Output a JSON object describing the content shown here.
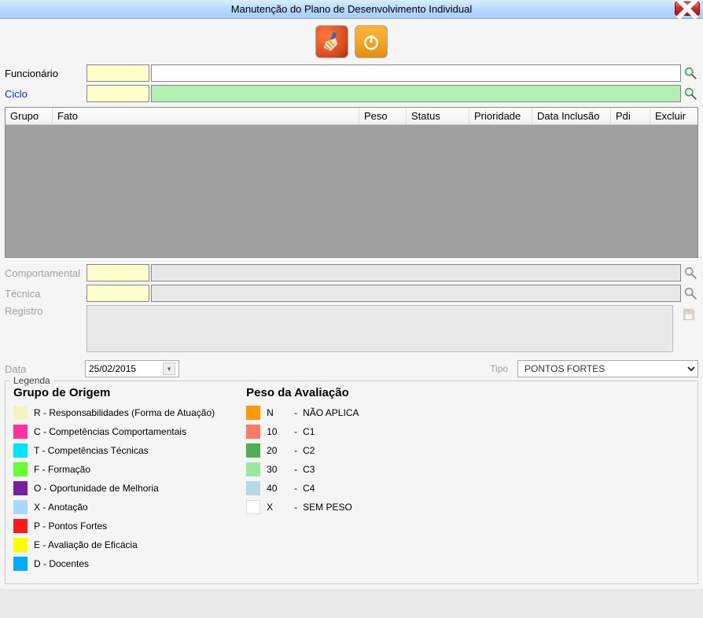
{
  "window": {
    "title": "Manutenção do Plano de Desenvolvimento Individual"
  },
  "form": {
    "funcionario_label": "Funcionário",
    "ciclo_label": "Ciclo",
    "comportamental_label": "Comportamental",
    "tecnica_label": "Técnica",
    "registro_label": "Registro",
    "data_label": "Data",
    "tipo_label": "Tipo",
    "data_value": "25/02/2015",
    "tipo_value": "PONTOS FORTES"
  },
  "grid": {
    "cols": {
      "grupo": "Grupo",
      "fato": "Fato",
      "peso": "Peso",
      "status": "Status",
      "prioridade": "Prioridade",
      "dataInclusao": "Data Inclusão",
      "pdi": "Pdi",
      "excluir": "Excluir"
    }
  },
  "legend": {
    "box_title": "Legenda",
    "origem_title": "Grupo de Origem",
    "origem": [
      {
        "color": "#f7f3c0",
        "text": "R - Responsabilidades (Forma de Atuação)"
      },
      {
        "color": "#ff3399",
        "text": "C - Competências Comportamentais"
      },
      {
        "color": "#00e5ff",
        "text": "T - Competências Técnicas"
      },
      {
        "color": "#66ff33",
        "text": "F - Formação"
      },
      {
        "color": "#7a1fa2",
        "text": "O - Oportunidade de Melhoria"
      },
      {
        "color": "#a8d8ff",
        "text": "X - Anotação"
      },
      {
        "color": "#ff1a1a",
        "text": "P - Pontos Fortes"
      },
      {
        "color": "#ffff00",
        "text": "E - Avaliação de Eficácia"
      },
      {
        "color": "#00aaff",
        "text": "D - Docentes"
      }
    ],
    "peso_title": "Peso da Avaliação",
    "peso": [
      {
        "color": "#ff9900",
        "code": "N",
        "label": "NÃO APLICA"
      },
      {
        "color": "#ff7a66",
        "code": "10",
        "label": "C1"
      },
      {
        "color": "#4caf50",
        "code": "20",
        "label": "C2"
      },
      {
        "color": "#9be6a1",
        "code": "30",
        "label": "C3"
      },
      {
        "color": "#b8d8e8",
        "code": "40",
        "label": "C4"
      },
      {
        "color": "#ffffff",
        "code": "X",
        "label": "SEM PESO"
      }
    ]
  }
}
